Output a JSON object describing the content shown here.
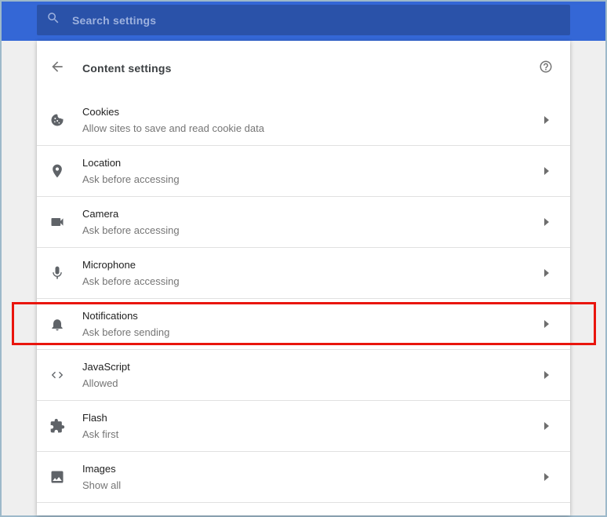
{
  "toolbar": {
    "search": {
      "placeholder": "Search settings",
      "value": ""
    }
  },
  "header": {
    "title": "Content settings",
    "back_icon": "arrow-back",
    "help_icon": "help-outline"
  },
  "settings": [
    {
      "icon": "cookie-icon",
      "title": "Cookies",
      "subtitle": "Allow sites to save and read cookie data",
      "highlighted": false
    },
    {
      "icon": "location-icon",
      "title": "Location",
      "subtitle": "Ask before accessing",
      "highlighted": false
    },
    {
      "icon": "camera-icon",
      "title": "Camera",
      "subtitle": "Ask before accessing",
      "highlighted": false
    },
    {
      "icon": "microphone-icon",
      "title": "Microphone",
      "subtitle": "Ask before accessing",
      "highlighted": false
    },
    {
      "icon": "notifications-icon",
      "title": "Notifications",
      "subtitle": "Ask before sending",
      "highlighted": true
    },
    {
      "icon": "javascript-icon",
      "title": "JavaScript",
      "subtitle": "Allowed",
      "highlighted": false
    },
    {
      "icon": "flash-icon",
      "title": "Flash",
      "subtitle": "Ask first",
      "highlighted": false
    },
    {
      "icon": "images-icon",
      "title": "Images",
      "subtitle": "Show all",
      "highlighted": false
    }
  ],
  "javascript_icon_glyph": "< >",
  "colors": {
    "toolbar-blue": "#3467d6",
    "searchfield-blue": "#2a52a9",
    "page-bg": "#efefef",
    "card-bg": "#ffffff",
    "divider": "#e0e0e0",
    "title-text": "#212121",
    "subtitle-text": "#757575",
    "icon-gray": "#5f6368",
    "placeholder-blue": "#9db1de",
    "highlight-red": "#e9150d",
    "frame-border": "#9db9ca"
  }
}
